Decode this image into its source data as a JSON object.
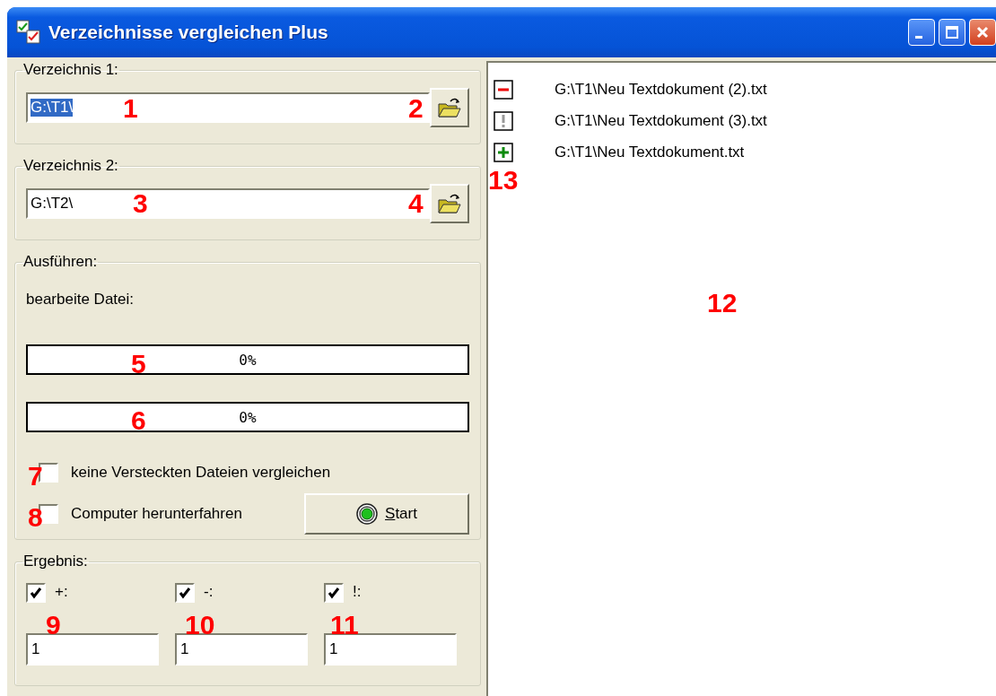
{
  "window": {
    "title": "Verzeichnisse vergleichen Plus"
  },
  "directory_1": {
    "label": "Verzeichnis 1:",
    "value": "G:\\T1\\",
    "text_selected": true
  },
  "directory_2": {
    "label": "Verzeichnis 2:",
    "value": "G:\\T2\\",
    "text_selected": false
  },
  "run": {
    "label": "Ausführen:",
    "status_label": "bearbeite Datei:",
    "progress": [
      {
        "level": 0,
        "reading": "0%"
      },
      {
        "level": 0,
        "reading": "0%"
      }
    ],
    "options": [
      {
        "label": "keine Versteckten Dateien vergleichen",
        "checked": false
      },
      {
        "label": "Computer herunterfahren",
        "checked": false
      }
    ],
    "start_button": {
      "label": "Start"
    }
  },
  "result": {
    "label": "Ergebnis:",
    "filters": [
      {
        "label": "+:",
        "checked": true,
        "value": "1"
      },
      {
        "label": "-:",
        "checked": true,
        "value": "1"
      },
      {
        "label": "!:",
        "checked": true,
        "value": "1"
      }
    ]
  },
  "file_list": [
    {
      "kind": "removed",
      "path": "G:\\T1\\Neu Textdokument (2).txt"
    },
    {
      "kind": "changed",
      "path": "G:\\T1\\Neu Textdokument (3).txt"
    },
    {
      "kind": "added",
      "path": "G:\\T1\\Neu Textdokument.txt"
    }
  ],
  "annotations": [
    {
      "label": "1"
    },
    {
      "label": "2"
    },
    {
      "label": "3"
    },
    {
      "label": "4"
    },
    {
      "label": "5"
    },
    {
      "label": "6"
    },
    {
      "label": "7"
    },
    {
      "label": "8"
    },
    {
      "label": "9"
    },
    {
      "label": "10"
    },
    {
      "label": "11"
    },
    {
      "label": "12"
    },
    {
      "label": "13"
    }
  ]
}
